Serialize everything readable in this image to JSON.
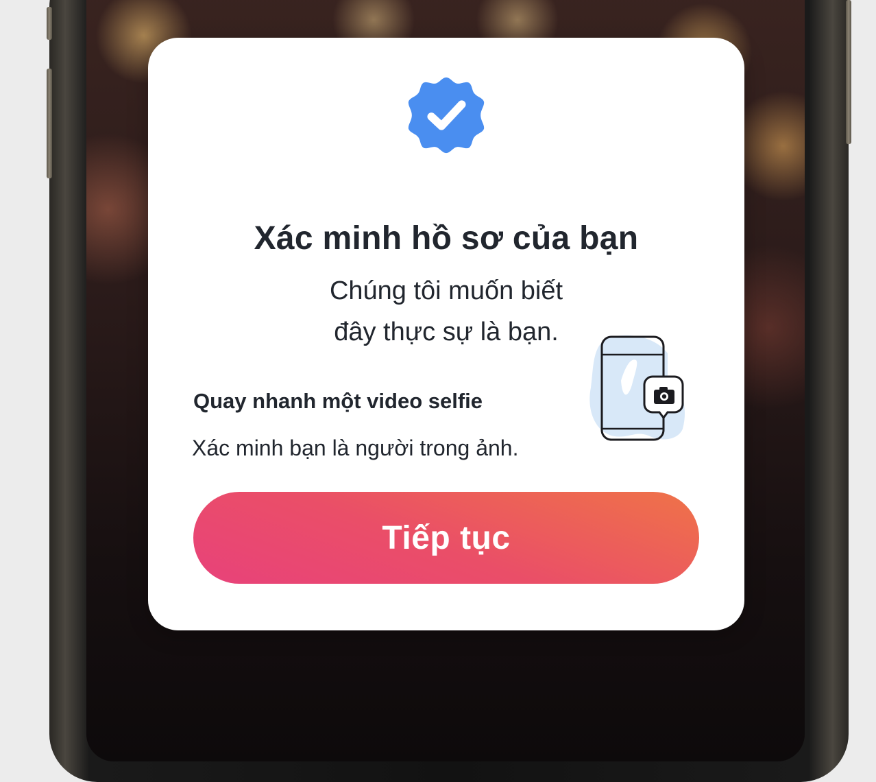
{
  "dialog": {
    "title": "Xác minh hồ sơ của bạn",
    "subtitle_line1": "Chúng tôi muốn biết",
    "subtitle_line2": "đây thực sự là bạn.",
    "badge_icon": "verified-badge-icon",
    "badge_color": "#4a8ef0"
  },
  "feature": {
    "title": "Quay nhanh một video selfie",
    "description": "Xác minh bạn là người trong ảnh.",
    "illustration_icon": "phone-selfie-camera-icon",
    "illustration_accent": "#d8e8f8"
  },
  "actions": {
    "continue_label": "Tiếp tục",
    "continue_gradient_start": "#ef7348",
    "continue_gradient_end": "#e8427a"
  }
}
